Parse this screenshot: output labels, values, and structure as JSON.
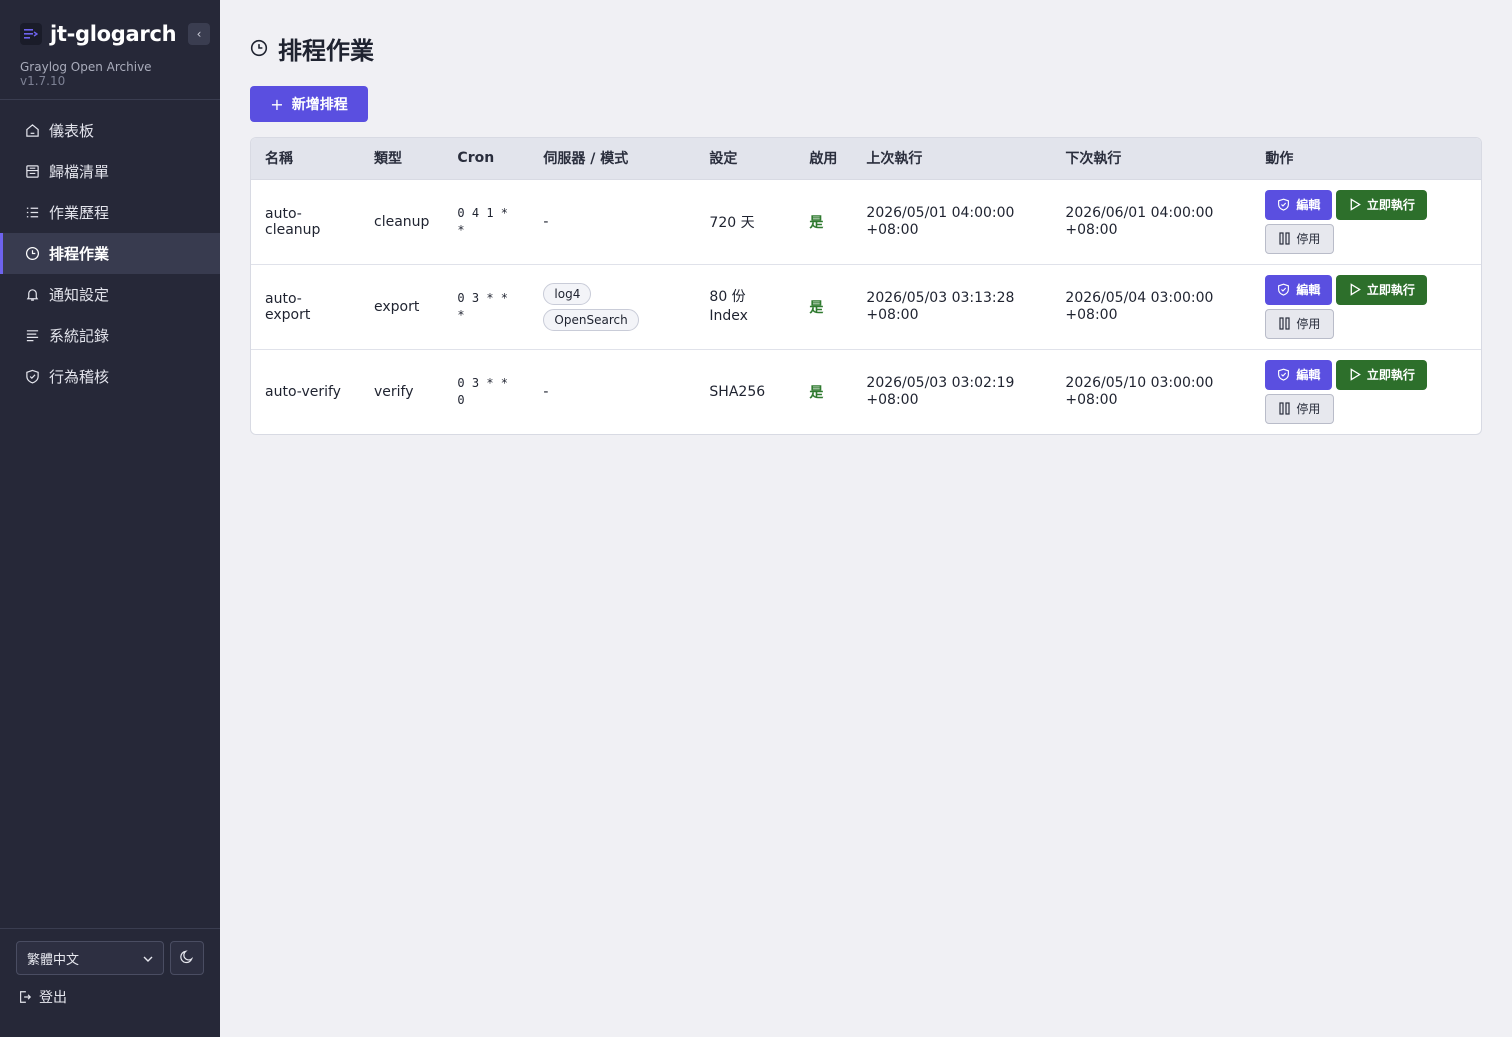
{
  "sidebar": {
    "brand_title": "jt-glogarch",
    "brand_sub": "Graylog Open Archive",
    "version": "v1.7.10",
    "nav": [
      {
        "label": "儀表板",
        "icon": "home-icon"
      },
      {
        "label": "歸檔清單",
        "icon": "archive-icon"
      },
      {
        "label": "作業歷程",
        "icon": "list-icon"
      },
      {
        "label": "排程作業",
        "icon": "clock-icon",
        "active": true
      },
      {
        "label": "通知設定",
        "icon": "bell-icon"
      },
      {
        "label": "系統記錄",
        "icon": "log-icon"
      },
      {
        "label": "行為稽核",
        "icon": "shield-icon"
      }
    ],
    "language": "繁體中文",
    "logout": "登出"
  },
  "page": {
    "title": "排程作業",
    "add_button": "新增排程"
  },
  "table": {
    "headers": [
      "名稱",
      "類型",
      "Cron",
      "伺服器 / 模式",
      "設定",
      "啟用",
      "上次執行",
      "下次執行",
      "動作"
    ],
    "rows": [
      {
        "name": "auto-\ncleanup",
        "type": "cleanup",
        "cron": "0 4 1 *\n*",
        "server": "-",
        "tags": [],
        "setting": "720 天",
        "enabled": "是",
        "last_run": "2026/05/01 04:00:00\n+08:00",
        "next_run": "2026/06/01 04:00:00\n+08:00"
      },
      {
        "name": "auto-export",
        "type": "export",
        "cron": "0 3 * *\n*",
        "server": "",
        "tags": [
          "log4",
          "OpenSearch"
        ],
        "setting": "80 份\nIndex",
        "enabled": "是",
        "last_run": "2026/05/03 03:13:28\n+08:00",
        "next_run": "2026/05/04 03:00:00\n+08:00"
      },
      {
        "name": "auto-verify",
        "type": "verify",
        "cron": "0 3 * *\n0",
        "server": "-",
        "tags": [],
        "setting": "SHA256",
        "enabled": "是",
        "last_run": "2026/05/03 03:02:19\n+08:00",
        "next_run": "2026/05/10 03:00:00\n+08:00"
      }
    ],
    "actions": {
      "edit": "編輯",
      "run": "立即執行",
      "disable": "停用"
    }
  }
}
